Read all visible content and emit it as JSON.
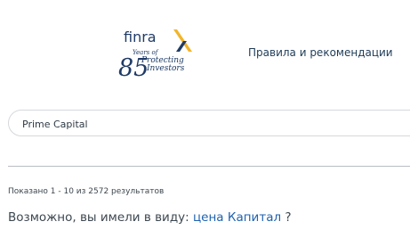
{
  "header": {
    "logo": {
      "brand": "FINRA",
      "anniversary": "85",
      "tagline_line1": "Years of",
      "tagline_line2": "Protecting",
      "tagline_line3": "Investors",
      "colors": {
        "navy": "#1f3b66",
        "gold": "#f2b52a"
      }
    },
    "nav_label": "Правила и рекомендации"
  },
  "search": {
    "value": "Prime Capital",
    "placeholder": ""
  },
  "results": {
    "summary": "Показано 1 - 10 из 2572 результатов",
    "suggestion_prefix": "Возможно, вы имели в виду: ",
    "suggestion_link": "цена Капитал",
    "suggestion_suffix": " ?"
  },
  "colors": {
    "link": "#1f62b0",
    "text": "#3d4750",
    "nav": "#1f3b57"
  }
}
